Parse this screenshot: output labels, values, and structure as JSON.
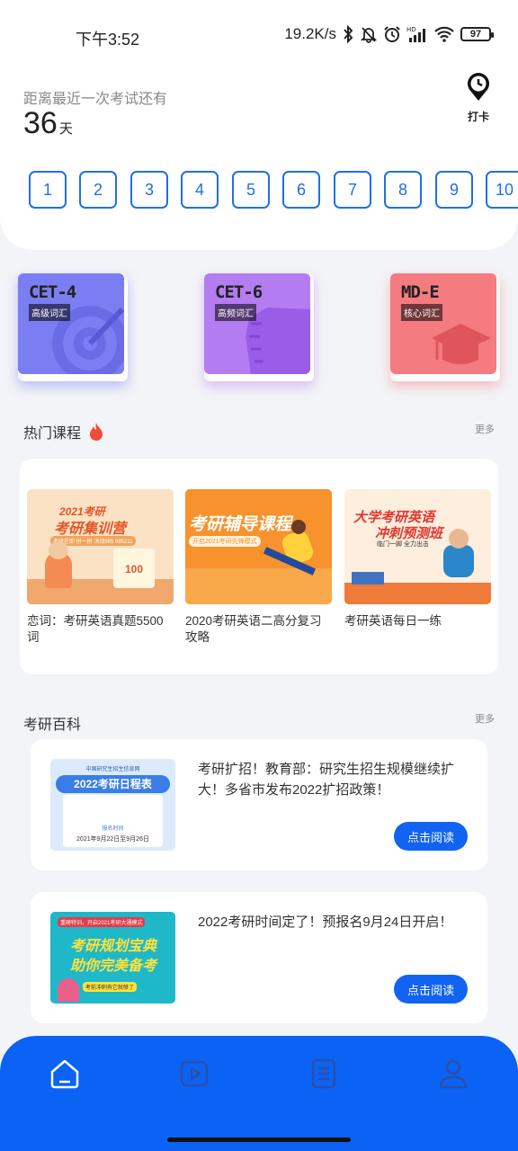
{
  "status_bar": {
    "time": "下午3:52",
    "net_speed": "19.2K/s",
    "battery": "97"
  },
  "countdown": {
    "label": "距离最近一次考试还有",
    "days": "36",
    "unit": "天"
  },
  "checkin": {
    "label": "打卡",
    "icon": "clock-pin-icon"
  },
  "days": [
    "1",
    "2",
    "3",
    "4",
    "5",
    "6",
    "7",
    "8",
    "9",
    "10"
  ],
  "books": [
    {
      "title": "CET-4",
      "tag": "高级词汇",
      "color": "#7b7df2",
      "icon": "target-icon"
    },
    {
      "title": "CET-6",
      "tag": "高频词汇",
      "color": "#b47cf1",
      "icon": "hand-icon"
    },
    {
      "title": "MD-E",
      "tag": "核心词汇",
      "color": "#f47b80",
      "icon": "grad-cap-icon"
    }
  ],
  "hot_courses": {
    "title": "热门课程",
    "more": "更多",
    "items": [
      {
        "name": "恋词：考研英语真题5500词",
        "img_title": "2021考研",
        "img_sub": "考研集训营",
        "img_badge": "100",
        "img_line": "考研在即 拼一拼 决战985 985211"
      },
      {
        "name": "2020考研英语二高分复习攻略",
        "img_title": "考研辅导课程",
        "img_sub": "开启2021考研先锋模式"
      },
      {
        "name": "考研英语每日一练",
        "img_title": "大学考研英语",
        "img_sub": "冲刺预测班",
        "img_line": "临门一脚 全力出击"
      }
    ]
  },
  "encyclopedia": {
    "title": "考研百科",
    "more": "更多",
    "articles": [
      {
        "text": "考研扩招！教育部：研究生招生规模继续扩大！多省市发布2022扩招政策！",
        "button": "点击阅读",
        "img_header": "中国研究生招生信息网",
        "img_title": "2022考研日程表",
        "img_sub": "报名时间",
        "img_date": "2021年9月22日至9月26日"
      },
      {
        "text": "2022考研时间定了！预报名9月24日开启！",
        "button": "点击阅读",
        "img_header": "重磅特训，开启2021考研大通模式",
        "img_title": "考研规划宝典",
        "img_sub": "助你完美备考",
        "img_footer": "考前冲刺有它就够了"
      }
    ]
  },
  "nav": [
    "home-icon",
    "video-icon",
    "list-icon",
    "profile-icon"
  ]
}
